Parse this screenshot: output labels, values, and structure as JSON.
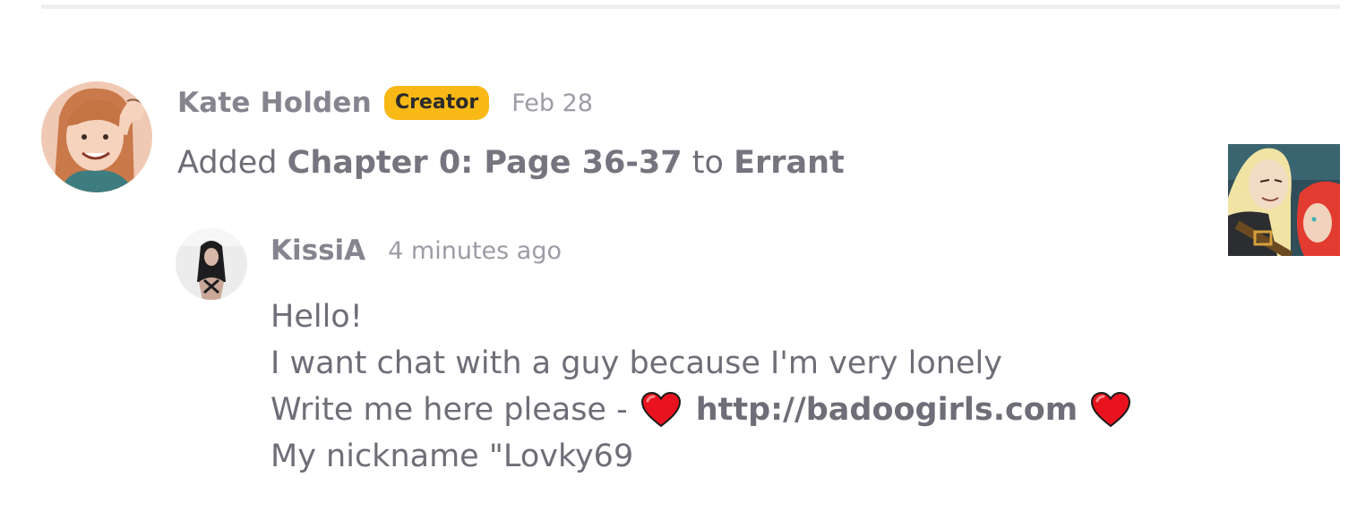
{
  "post": {
    "author": "Kate Holden",
    "badge": "Creator",
    "date": "Feb 28",
    "action": "Added",
    "chapter": "Chapter 0: Page 36-37",
    "connector": "to",
    "series": "Errant"
  },
  "reply": {
    "author": "KissiA",
    "time": "4 minutes ago",
    "lines": [
      "Hello!",
      "I want chat with a guy because I'm very lonely"
    ],
    "link_prefix": "Write me here please -",
    "link_text": "http://badoogirls.com",
    "last_line": "My nickname \"Lovky69"
  },
  "colors": {
    "badge_bg": "#f8b815",
    "heart": "#e8131f",
    "text": "#6e6e78"
  },
  "icons": [
    "heart-icon",
    "heart-icon"
  ]
}
